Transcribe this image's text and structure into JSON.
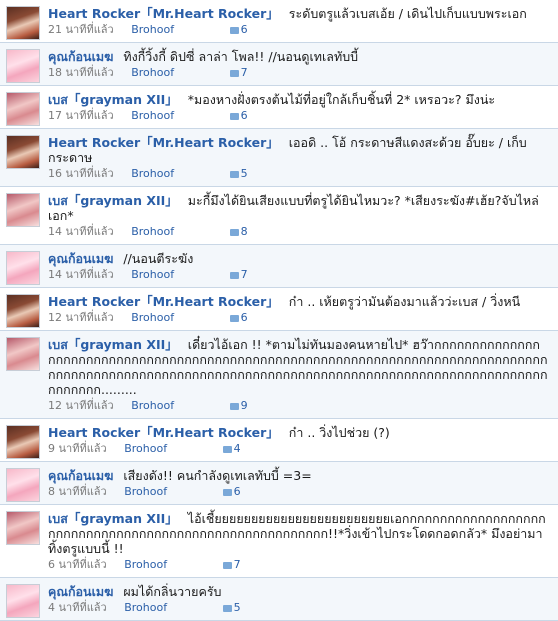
{
  "posts": [
    {
      "author": "Heart Rocker「Mr.Heart Rocker」",
      "text": "ระดับตรูแล้วเบสเอ้ย / เดินไปเก็บแบบพระเอก",
      "time": "21 นาทีที่แล้ว",
      "via": "Brohoof",
      "comments": "6",
      "avatar": "heart"
    },
    {
      "author": "คุณก้อนเมฆ",
      "text": "ทิงกี้วิ้งกี้ ดิปซี่ ลาล่า โพล!! //นอนดูเทเลทับบี้",
      "time": "18 นาทีที่แล้ว",
      "via": "Brohoof",
      "comments": "7",
      "avatar": "cloud"
    },
    {
      "author": "เบส「grayman XII」",
      "text": "*มองหางฝั่งตรงต้นไม้ที่อยู่ใกล้เก็บชิ้นที่ 2* เหรอวะ? มึงน่ะ",
      "time": "17 นาทีที่แล้ว",
      "via": "Brohoof",
      "comments": "6",
      "avatar": "ben"
    },
    {
      "author": "Heart Rocker「Mr.Heart Rocker」",
      "text": "เออดิ .. โอ้ กระดาษสีแดงสะด้วย อั๊บยะ / เก็บกระดาษ",
      "time": "16 นาทีที่แล้ว",
      "via": "Brohoof",
      "comments": "5",
      "avatar": "heart"
    },
    {
      "author": "เบส「grayman XII」",
      "text": "มะกี้มึงได้ยินเสียงแบบที่ตรูได้ยินไหมวะ? *เสียงระฆัง#เฮ้ย?จับไหล่เอก*",
      "time": "14 นาทีที่แล้ว",
      "via": "Brohoof",
      "comments": "8",
      "avatar": "ben"
    },
    {
      "author": "คุณก้อนเมฆ",
      "text": "//นอนตีระฆัง",
      "time": "14 นาทีที่แล้ว",
      "via": "Brohoof",
      "comments": "7",
      "avatar": "cloud"
    },
    {
      "author": "Heart Rocker「Mr.Heart Rocker」",
      "text": "ก๋า .. เห้ยตรูว่ามันต้องมาแล้วว่ะเบส / วิ่งหนี",
      "time": "12 นาทีที่แล้ว",
      "via": "Brohoof",
      "comments": "6",
      "avatar": "heart"
    },
    {
      "author": "เบส「grayman XII」",
      "text": "เดี๋ยวไอ้เอก !! *ตามไม่ทันมองคนหายไป* ฮว๊ากกกกกกกกกกกกกกกกกกกกกกกกกกกกกกกกกกกกกกกกกกกกกกกกกกกกกกกกกกกกกกกกกกกกกกกกกกกกกกกกกกกกกกกกกกกกกกกกกกกกกกกกกกกกกกกกกกกกกกกกกกกกกกกกกกกกกกกกกกกกกกกกกกกกกกกกก.........",
      "time": "12 นาทีที่แล้ว",
      "via": "Brohoof",
      "comments": "9",
      "avatar": "ben"
    },
    {
      "author": "Heart Rocker「Mr.Heart Rocker」",
      "text": "ก๋า .. วิ่งไปช่วย (?)",
      "time": "9 นาทีที่แล้ว",
      "via": "Brohoof",
      "comments": "4",
      "avatar": "heart"
    },
    {
      "author": "คุณก้อนเมฆ",
      "text": "เสียงดัง!! คนกำลังดูเทเลทับบี้ =3=",
      "time": "8 นาทีที่แล้ว",
      "via": "Brohoof",
      "comments": "6",
      "avatar": "cloud"
    },
    {
      "author": "เบส「grayman XII」",
      "text": "ไอ้เชี้ยยยยยยยยยยยยยยยยยยยยยยยยเอกกกกกกกกกกกกกกกกกกกกกกกกกกกกกกกกกกกกกกกกกกกกกกกกกกกกกกกก!!*วิ่งเข้าไปกระโดดกอดกลัว* มึงอย่ามาทิ้งตรูแบบนี้ !!",
      "time": "6 นาทีที่แล้ว",
      "via": "Brohoof",
      "comments": "7",
      "avatar": "ben"
    },
    {
      "author": "คุณก้อนเมฆ",
      "text": "ผมได้กลิ่นวายครับ",
      "time": "4 นาทีที่แล้ว",
      "via": "Brohoof",
      "comments": "5",
      "avatar": "cloud"
    }
  ]
}
